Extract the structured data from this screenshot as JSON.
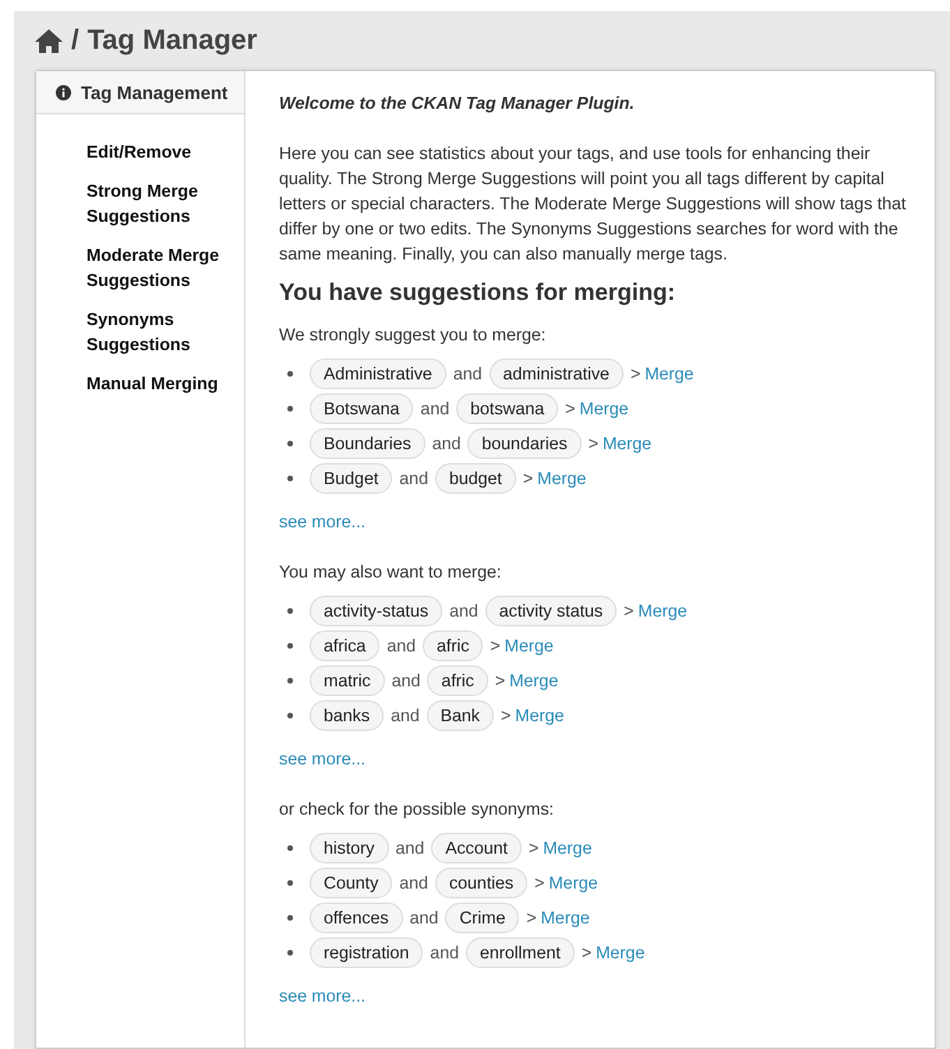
{
  "breadcrumb": {
    "separator": "/",
    "title": "Tag Manager"
  },
  "sidebar": {
    "heading": "Tag Management",
    "items": [
      {
        "label": "Edit/Remove"
      },
      {
        "label": "Strong Merge Suggestions"
      },
      {
        "label": "Moderate Merge Suggestions"
      },
      {
        "label": "Synonyms Suggestions"
      },
      {
        "label": "Manual Merging"
      }
    ]
  },
  "intro": {
    "welcome": "Welcome to the CKAN Tag Manager Plugin.",
    "text": "Here you can see statistics about your tags, and use tools for enhancing their quality. The Strong Merge Suggestions will point you all tags different by capital letters or special characters. The Moderate Merge Suggestions will show tags that differ by one or two edits. The Synonyms Suggestions searches for word with the same meaning. Finally, you can also manually merge tags."
  },
  "heading": "You have suggestions for merging:",
  "sections": [
    {
      "label": "We strongly suggest you to merge:",
      "more": "see more...",
      "pairs": [
        {
          "a": "Administrative",
          "joiner": "and",
          "b": "administrative",
          "arrow": ">",
          "link": "Merge"
        },
        {
          "a": "Botswana",
          "joiner": "and",
          "b": "botswana",
          "arrow": ">",
          "link": "Merge"
        },
        {
          "a": "Boundaries",
          "joiner": "and",
          "b": "boundaries",
          "arrow": ">",
          "link": "Merge"
        },
        {
          "a": "Budget",
          "joiner": "and",
          "b": "budget",
          "arrow": ">",
          "link": "Merge"
        }
      ]
    },
    {
      "label": "You may also want to merge:",
      "more": "see more...",
      "pairs": [
        {
          "a": "activity-status",
          "joiner": "and",
          "b": "activity status",
          "arrow": ">",
          "link": "Merge"
        },
        {
          "a": "africa",
          "joiner": "and",
          "b": "afric",
          "arrow": ">",
          "link": "Merge"
        },
        {
          "a": "matric",
          "joiner": "and",
          "b": "afric",
          "arrow": ">",
          "link": "Merge"
        },
        {
          "a": "banks",
          "joiner": "and",
          "b": "Bank",
          "arrow": ">",
          "link": "Merge"
        }
      ]
    },
    {
      "label": "or check for the possible synonyms:",
      "more": "see more...",
      "pairs": [
        {
          "a": "history",
          "joiner": "and",
          "b": "Account",
          "arrow": ">",
          "link": "Merge"
        },
        {
          "a": "County",
          "joiner": "and",
          "b": "counties",
          "arrow": ">",
          "link": "Merge"
        },
        {
          "a": "offences",
          "joiner": "and",
          "b": "Crime",
          "arrow": ">",
          "link": "Merge"
        },
        {
          "a": "registration",
          "joiner": "and",
          "b": "enrollment",
          "arrow": ">",
          "link": "Merge"
        }
      ]
    }
  ]
}
